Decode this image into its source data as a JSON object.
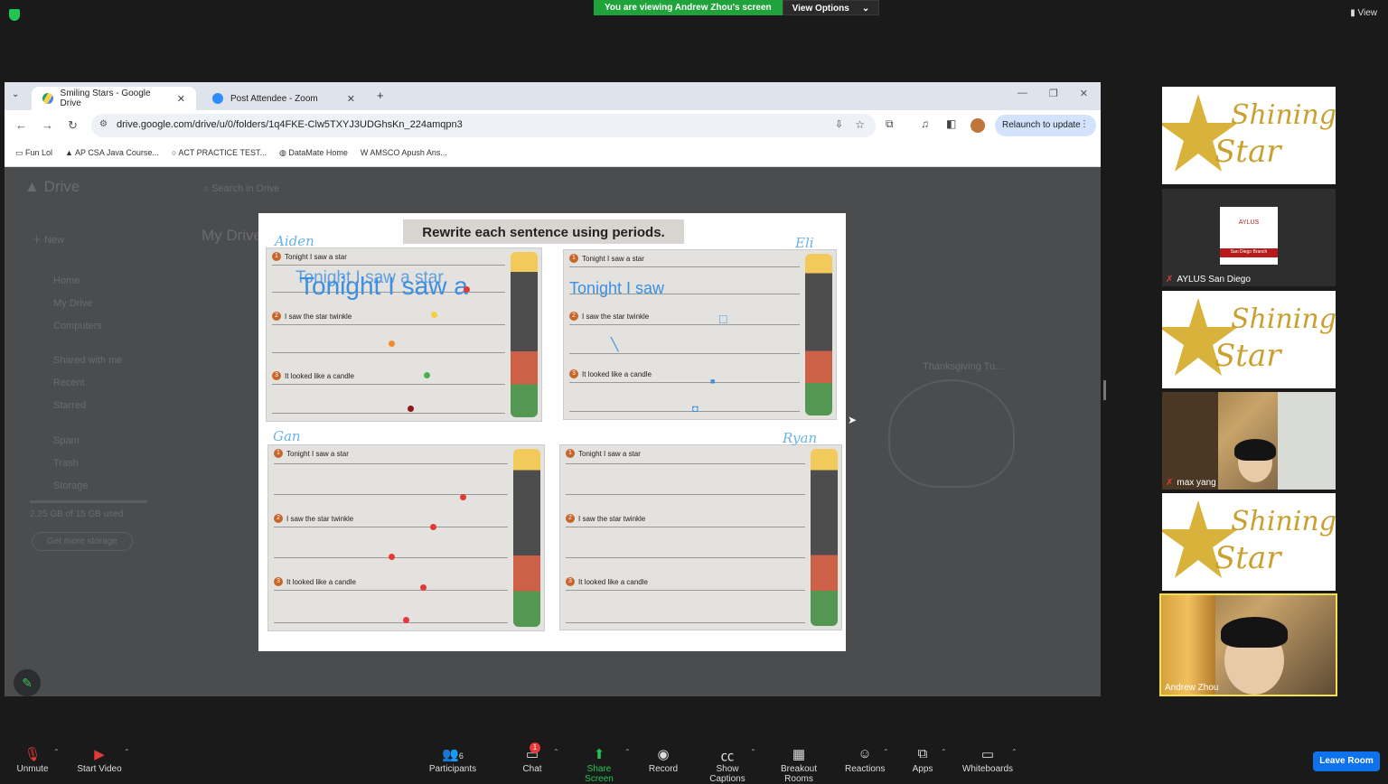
{
  "zoom": {
    "viewing_banner": "You are viewing Andrew Zhou's screen",
    "view_options": "View Options",
    "top_view": "View"
  },
  "browser": {
    "tabs": [
      {
        "label": "Smiling Stars - Google Drive"
      },
      {
        "label": "Post Attendee - Zoom"
      }
    ],
    "url": "drive.google.com/drive/u/0/folders/1q4FKE-Clw5TXYJ3UDGhsKn_224amqpn3",
    "relaunch": "Relaunch to update",
    "bookmarks": [
      "Fun Lol",
      "AP CSA Java Course...",
      "ACT PRACTICE TEST...",
      "DataMate Home",
      "AMSCO Apush Ans..."
    ]
  },
  "drive": {
    "logo": "Drive",
    "search_placeholder": "Search in Drive",
    "new_button": "New",
    "nav": [
      "Home",
      "My Drive",
      "Computers",
      "Shared with me",
      "Recent",
      "Starred",
      "Spam",
      "Trash",
      "Storage"
    ],
    "storage_used": "2.25 GB of 15 GB used",
    "get_more_storage": "Get more storage",
    "page_title": "My Drive",
    "file_thanksgiving": "Thanksgiving Tu..."
  },
  "worksheet": {
    "title": "Rewrite each sentence using periods.",
    "sentences": [
      "Tonight I saw a star",
      "I saw the star twinkle",
      "It looked like a candle"
    ],
    "names": [
      "Aiden",
      "Eli",
      "Gan",
      "Ryan"
    ],
    "handwriting_1a": "Tonight I saw a star",
    "handwriting_1b": "Tonight I saw a",
    "handwriting_2": "Tonight I saw"
  },
  "participants_panel": {
    "tiles": [
      {
        "type": "logo",
        "text_line1": "Shining",
        "text_line2": "Star"
      },
      {
        "type": "org",
        "name": "AYLUS San Diego",
        "logo_text": "AYLUS",
        "logo_sub": "San Diego Branch"
      },
      {
        "type": "logo",
        "text_line1": "Shining",
        "text_line2": "Star"
      },
      {
        "type": "camera",
        "name": "max yang"
      },
      {
        "type": "logo",
        "text_line1": "Shining",
        "text_line2": "Star"
      },
      {
        "type": "camera",
        "name": "Andrew Zhou"
      }
    ]
  },
  "toolbar": {
    "unmute": "Unmute",
    "start_video": "Start Video",
    "participants": "Participants",
    "participants_count": "6",
    "chat": "Chat",
    "chat_badge": "1",
    "share_screen": "Share Screen",
    "record": "Record",
    "show_captions": "Show Captions",
    "breakout_rooms": "Breakout Rooms",
    "reactions": "Reactions",
    "apps": "Apps",
    "whiteboards": "Whiteboards",
    "leave_room": "Leave Room"
  },
  "colors": {
    "banner_green": "#1fa33a",
    "share_green": "#23c552",
    "leave_blue": "#0e72ed",
    "annotation_blue": "#3d8fe0"
  }
}
